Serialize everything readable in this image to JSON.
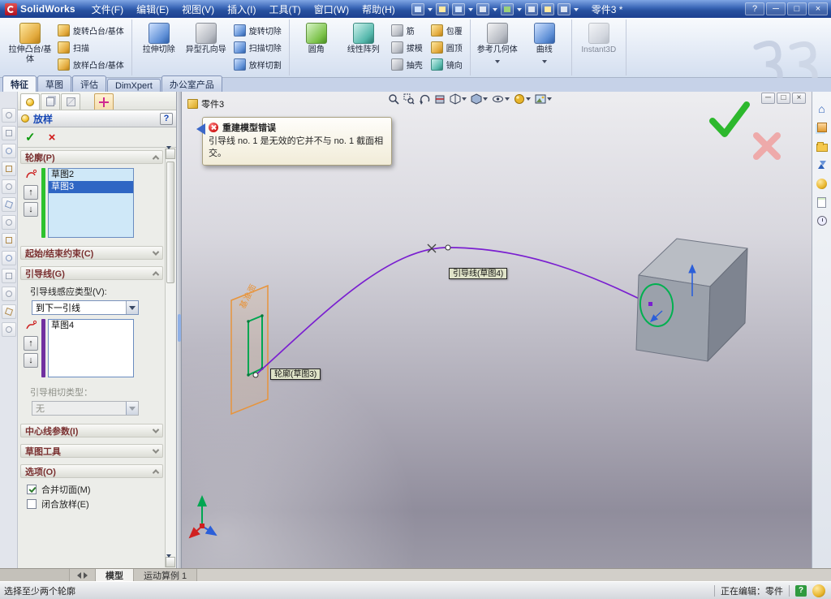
{
  "titlebar": {
    "app_name": "SolidWorks",
    "menus": [
      "文件(F)",
      "编辑(E)",
      "视图(V)",
      "插入(I)",
      "工具(T)",
      "窗口(W)",
      "帮助(H)"
    ],
    "doc_title": "零件3 *",
    "help_glyph": "?",
    "min_glyph": "─",
    "max_glyph": "□",
    "close_glyph": "×"
  },
  "ribbon": {
    "extrude_boss": "拉伸凸台/基体",
    "revolve_boss": "旋转凸台/基体",
    "sweep": "扫描",
    "loft_boss": "放样凸台/基体",
    "extrude_cut": "拉伸切除",
    "hole_wizard": "异型孔向导",
    "revolve_cut": "旋转切除",
    "sweep_cut": "扫描切除",
    "loft_cut": "放样切割",
    "fillet": "圆角",
    "linear_pattern": "线性阵列",
    "rib": "筋",
    "draft": "拔模",
    "shell": "抽壳",
    "wrap": "包覆",
    "dome": "圆顶",
    "mirror": "镜向",
    "reference_geometry": "参考几何体",
    "curves": "曲线",
    "instant3d": "Instant3D"
  },
  "command_tabs": [
    "特征",
    "草图",
    "评估",
    "DimXpert",
    "办公室产品"
  ],
  "property_manager": {
    "title": "放样",
    "help_glyph": "?",
    "ok_glyph": "✓",
    "cancel_glyph": "×",
    "glyphs": {
      "up": "↑",
      "down": "↓"
    },
    "profiles": {
      "header": "轮廓(P)",
      "items": [
        "草图2",
        "草图3"
      ]
    },
    "start_end": {
      "header": "起始/结束约束(C)"
    },
    "guides": {
      "header": "引导线(G)",
      "influence_label": "引导线感应类型(V):",
      "influence_value": "到下一引线",
      "items": [
        "草图4"
      ],
      "tangency_label": "引导相切类型：",
      "tangency_value": "无"
    },
    "centerline": {
      "header": "中心线参数(I)"
    },
    "sketch_tools": {
      "header": "草图工具"
    },
    "options": {
      "header": "选项(O)",
      "merge_faces": "合并切面(M)",
      "close_loft": "闭合放样(E)"
    }
  },
  "viewport": {
    "feature_tree_root": "零件3",
    "error_tooltip": {
      "title": "重建模型错误",
      "message": "引导线 no. 1 是无效的它并不与 no. 1 截面相交。"
    },
    "guide_label": "引导线(草图4)",
    "profile_label": "轮廓(草图3)",
    "plane_label": "基准面"
  },
  "document_tabs": {
    "model": "模型",
    "motion": "运动算例 1"
  },
  "statusbar": {
    "message": "选择至少两个轮廓",
    "editing": "正在编辑：零件",
    "help_glyph": "?"
  },
  "colors": {
    "selection_blue": "#2f66c4",
    "guide_purple": "#7a1fd0",
    "profile_green": "#00a651",
    "plane_orange": "#e8943a",
    "check_green": "#2db82d",
    "error_red": "#d01818"
  }
}
